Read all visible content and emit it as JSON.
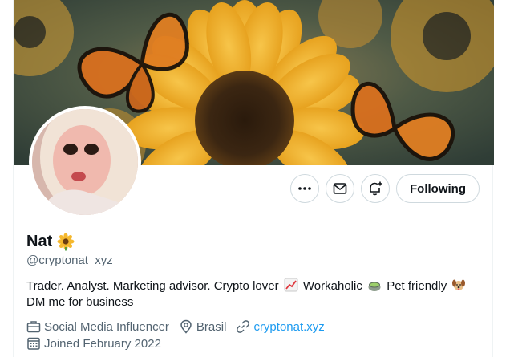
{
  "profile": {
    "display_name": "Nat",
    "name_emoji": "sunflower-emoji",
    "handle": "@cryptonat_xyz",
    "bio_line1_a": "Trader. Analyst. Marketing advisor. Crypto lover",
    "bio_line1_b": "Workaholic",
    "bio_line1_c": "Pet friendly",
    "bio_line2": "DM me for business",
    "category": "Social Media Influencer",
    "location": "Brasil",
    "website": "cryptonat.xyz",
    "joined": "Joined February 2022"
  },
  "actions": {
    "more_icon": "more-icon",
    "message_icon": "mail-icon",
    "notify_icon": "bell-plus-icon",
    "follow_label": "Following"
  },
  "colors": {
    "link": "#1d9bf0",
    "muted": "#536471",
    "border": "#cfd9de"
  }
}
